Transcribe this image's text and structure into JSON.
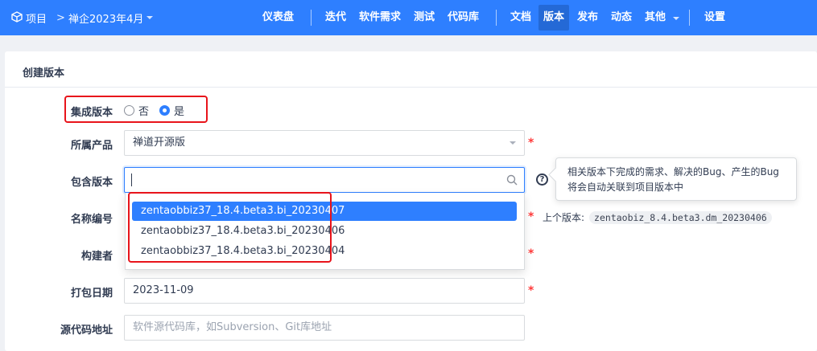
{
  "topbar": {
    "project_label": "项目",
    "separator": ">",
    "execution_label": "禅企2023年4月",
    "nav": [
      {
        "label": "仪表盘"
      },
      {
        "label": "迭代"
      },
      {
        "label": "软件需求"
      },
      {
        "label": "测试"
      },
      {
        "label": "代码库"
      },
      {
        "label": "文档"
      },
      {
        "label": "版本",
        "active": true
      },
      {
        "label": "发布"
      },
      {
        "label": "动态"
      },
      {
        "label": "其他"
      },
      {
        "label": "设置"
      }
    ]
  },
  "form": {
    "title": "创建版本",
    "integrated": {
      "label": "集成版本",
      "options": [
        {
          "label": "否",
          "checked": false
        },
        {
          "label": "是",
          "checked": true
        }
      ]
    },
    "product": {
      "label": "所属产品",
      "value": "禅道开源版",
      "required_mark": "*"
    },
    "included_builds": {
      "label": "包含版本",
      "value": "",
      "dropdown": [
        "zentaobbiz37_18.4.beta3.bi_20230407",
        "zentaobbiz37_18.4.beta3.bi_20230406",
        "zentaobbiz37_18.4.beta3.bi_20230404"
      ],
      "selected_index": 0,
      "help_icon": "?",
      "tooltip": "相关版本下完成的需求、解决的Bug、产生的Bug将会自动关联到项目版本中"
    },
    "name": {
      "label": "名称编号",
      "required_mark": "*",
      "previous_label": "上个版本:",
      "previous_value": "zentaobiz_8.4.beta3.dm_20230406"
    },
    "builder": {
      "label": "构建者",
      "required_mark": "*"
    },
    "date": {
      "label": "打包日期",
      "value": "2023-11-09",
      "required_mark": "*"
    },
    "scm": {
      "label": "源代码地址",
      "placeholder": "软件源代码库，如Subversion、Git库地址"
    }
  },
  "colors": {
    "primary": "#2e7fff",
    "highlight": "#e8141b",
    "required": "#ff3a3a"
  }
}
